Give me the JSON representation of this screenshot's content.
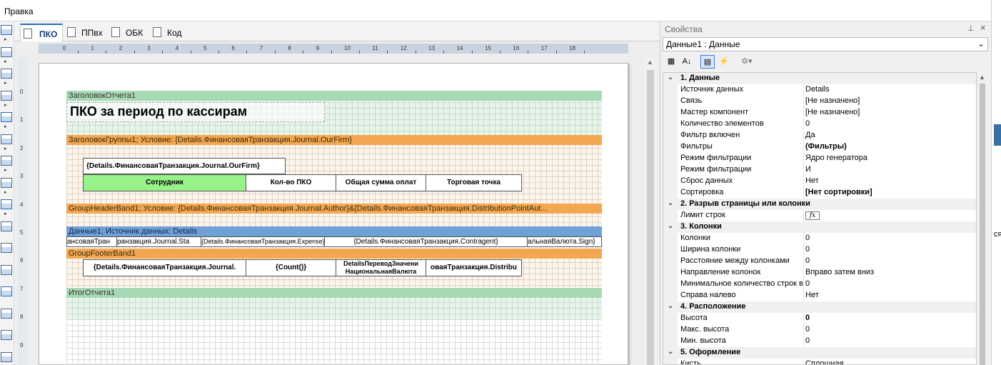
{
  "menu": {
    "edit": "Правка"
  },
  "right_edge": {
    "text": "ся"
  },
  "tabs": [
    {
      "label": "ПКО",
      "active": true
    },
    {
      "label": "ППвх",
      "active": false
    },
    {
      "label": "ОБК",
      "active": false
    },
    {
      "label": "Код",
      "active": false
    }
  ],
  "ruler": {
    "h_ticks": [
      "0",
      "1",
      "2",
      "3",
      "4",
      "5",
      "6",
      "7",
      "8",
      "9",
      "10",
      "11",
      "12",
      "13",
      "14",
      "15",
      "16",
      "17",
      "18"
    ],
    "v_ticks": [
      "0",
      "1",
      "2",
      "3",
      "4",
      "5",
      "6",
      "7",
      "8",
      "9"
    ]
  },
  "report": {
    "title_band": "ЗаголовокОтчета1",
    "title_text": "ПКО за период по кассирам",
    "group_header1": "ЗаголовокГруппы1; Условие: {Details.ФинансоваяТранзакция.Journal.OurFirm}",
    "ourfirm_field": "{Details.ФинансоваяТранзакция.Journal.OurFirm}",
    "columns": [
      "Сотрудник",
      "Кол-во ПКО",
      "Общая сумма оплат",
      "Торговая точка"
    ],
    "group_header_band1": "GroupHeaderBand1;  Условие:  {Details.ФинансоваяТранзакция.Journal.Author}&{Details.ФинансоваяТранзакция.DistributionPointAut...",
    "data_band": "Данные1; Источник данных: Details",
    "data_cells": [
      "ансоваяТран",
      "ранзакция.Journal.Sta",
      "{Details.ФинансоваяТранзакция.Expense}",
      "{Details.ФинансоваяТранзакция.Contragent}",
      "альнаяВалюта.Sign}"
    ],
    "group_footer_band": "GroupFooterBand1",
    "footer_cells": [
      "{Details.ФинансоваяТранзакция.Journal.",
      "{Count()}",
      "DetailsПереводЗначени\nНациональнаяВалюта",
      "оваяТранзакция.Distribu"
    ],
    "summary_band": "ИтогОтчета1"
  },
  "properties": {
    "panel_title": "Свойства",
    "component": "Данные1 : Данные",
    "categories": [
      {
        "label": "1. Данные",
        "rows": [
          {
            "name": "Источник данных",
            "value": "Details"
          },
          {
            "name": "Связь",
            "value": "[Не назначено]"
          },
          {
            "name": "Мастер компонент",
            "value": "[Не назначено]"
          },
          {
            "name": "Количество элементов",
            "value": "0"
          },
          {
            "name": "Фильтр включен",
            "value": "Да"
          },
          {
            "name": "Фильтры",
            "value": "(Фильтры)",
            "bold": true
          },
          {
            "name": "Режим фильтрации",
            "value": "Ядро генератора"
          },
          {
            "name": "Режим фильтрации",
            "value": "И"
          },
          {
            "name": "Сброс данных",
            "value": "Нет"
          },
          {
            "name": "Сортировка",
            "value": "[Нет сортировки]",
            "bold": true
          }
        ]
      },
      {
        "label": "2. Разрыв страницы или колонки",
        "rows": [
          {
            "name": "Лимит строк",
            "value": "fx",
            "fx": true
          }
        ]
      },
      {
        "label": "3. Колонки",
        "rows": [
          {
            "name": "Колонки",
            "value": "0"
          },
          {
            "name": "Ширина колонки",
            "value": "0"
          },
          {
            "name": "Расстояние между колонками",
            "value": "0"
          },
          {
            "name": "Направление колонок",
            "value": "Вправо затем вниз"
          },
          {
            "name": "Минимальное количество строк в",
            "value": "0"
          },
          {
            "name": "Справа налево",
            "value": "Нет"
          }
        ]
      },
      {
        "label": "4. Расположение",
        "rows": [
          {
            "name": "Высота",
            "value": "0",
            "bold": true
          },
          {
            "name": "Макс. высота",
            "value": "0"
          },
          {
            "name": "Мин. высота",
            "value": "0"
          }
        ]
      },
      {
        "label": "5. Оформление",
        "rows": [
          {
            "name": "Кисть",
            "value": "Сплошная"
          }
        ]
      }
    ]
  },
  "colors": {
    "band_green": "#a8d9b5",
    "band_orange": "#f2a750",
    "band_blue": "#6fa0d8",
    "header_cell_green": "#98f28a",
    "tab_accent": "#2a6ebb"
  }
}
